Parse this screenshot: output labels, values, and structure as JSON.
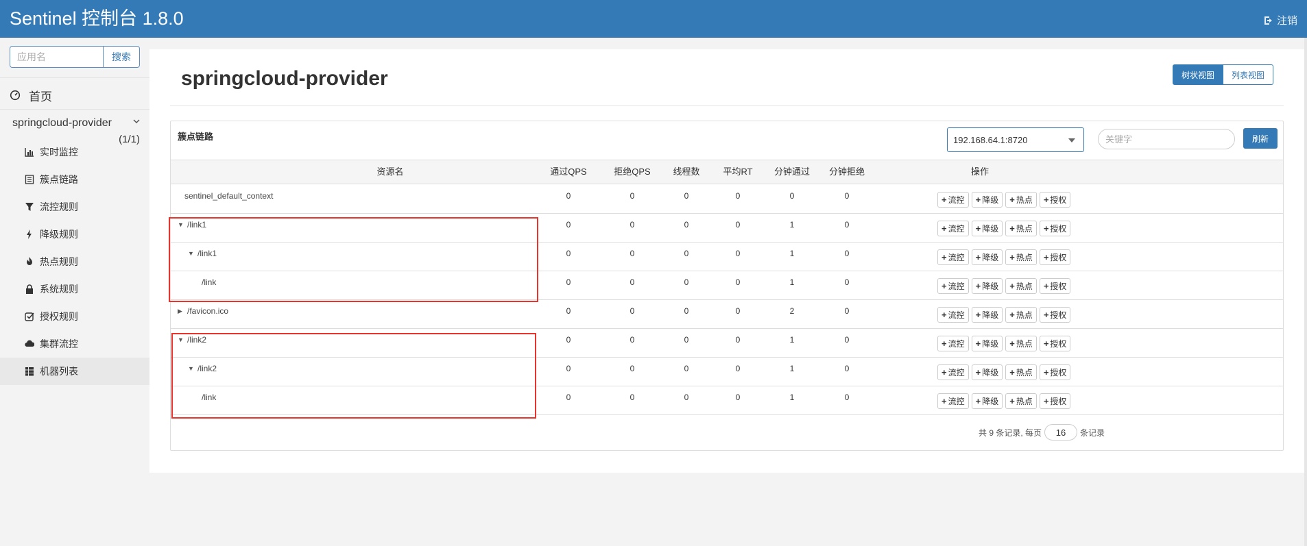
{
  "app": {
    "title": "Sentinel 控制台 1.8.0",
    "logout_label": "注销"
  },
  "sidebar": {
    "search_placeholder": "应用名",
    "search_button": "搜索",
    "home_label": "首页",
    "app_name": "springcloud-provider",
    "app_count": "(1/1)",
    "items": [
      {
        "label": "实时监控",
        "icon": "bar-chart-icon"
      },
      {
        "label": "簇点链路",
        "icon": "list-icon"
      },
      {
        "label": "流控规则",
        "icon": "filter-icon"
      },
      {
        "label": "降级规则",
        "icon": "flash-icon"
      },
      {
        "label": "热点规则",
        "icon": "fire-icon"
      },
      {
        "label": "系统规则",
        "icon": "lock-icon"
      },
      {
        "label": "授权规则",
        "icon": "check-icon"
      },
      {
        "label": "集群流控",
        "icon": "cloud-icon"
      },
      {
        "label": "机器列表",
        "icon": "grid-icon"
      }
    ],
    "active_item": "机器列表"
  },
  "main": {
    "page_title": "springcloud-provider",
    "view_tree": "树状视图",
    "view_list": "列表视图",
    "card_title": "簇点链路",
    "machine_selected": "192.168.64.1:8720",
    "keyword_placeholder": "关键字",
    "refresh_button": "刷新",
    "columns": [
      "资源名",
      "通过QPS",
      "拒绝QPS",
      "线程数",
      "平均RT",
      "分钟通过",
      "分钟拒绝",
      "操作"
    ],
    "rows": [
      {
        "name": "sentinel_default_context",
        "toggle": "",
        "pass_qps": "0",
        "block_qps": "0",
        "threads": "0",
        "avg_rt": "0",
        "min_pass": "0",
        "min_block": "0"
      },
      {
        "name": "/link1",
        "toggle": "▼",
        "pass_qps": "0",
        "block_qps": "0",
        "threads": "0",
        "avg_rt": "0",
        "min_pass": "1",
        "min_block": "0"
      },
      {
        "name": "/link1",
        "toggle": "▼",
        "pass_qps": "0",
        "block_qps": "0",
        "threads": "0",
        "avg_rt": "0",
        "min_pass": "1",
        "min_block": "0"
      },
      {
        "name": "/link",
        "toggle": "",
        "pass_qps": "0",
        "block_qps": "0",
        "threads": "0",
        "avg_rt": "0",
        "min_pass": "1",
        "min_block": "0"
      },
      {
        "name": "/favicon.ico",
        "toggle": "▶",
        "pass_qps": "0",
        "block_qps": "0",
        "threads": "0",
        "avg_rt": "0",
        "min_pass": "2",
        "min_block": "0"
      },
      {
        "name": "/link2",
        "toggle": "▼",
        "pass_qps": "0",
        "block_qps": "0",
        "threads": "0",
        "avg_rt": "0",
        "min_pass": "1",
        "min_block": "0"
      },
      {
        "name": "/link2",
        "toggle": "▼",
        "pass_qps": "0",
        "block_qps": "0",
        "threads": "0",
        "avg_rt": "0",
        "min_pass": "1",
        "min_block": "0"
      },
      {
        "name": "/link",
        "toggle": "",
        "pass_qps": "0",
        "block_qps": "0",
        "threads": "0",
        "avg_rt": "0",
        "min_pass": "1",
        "min_block": "0"
      }
    ],
    "ops": [
      "流控",
      "降级",
      "热点",
      "授权"
    ],
    "pager": {
      "prefix": "共 9 条记录, 每页",
      "page_size": "16",
      "suffix": "条记录"
    }
  },
  "colors": {
    "primary": "#337ab7",
    "highlight_box": "#e8342d"
  }
}
